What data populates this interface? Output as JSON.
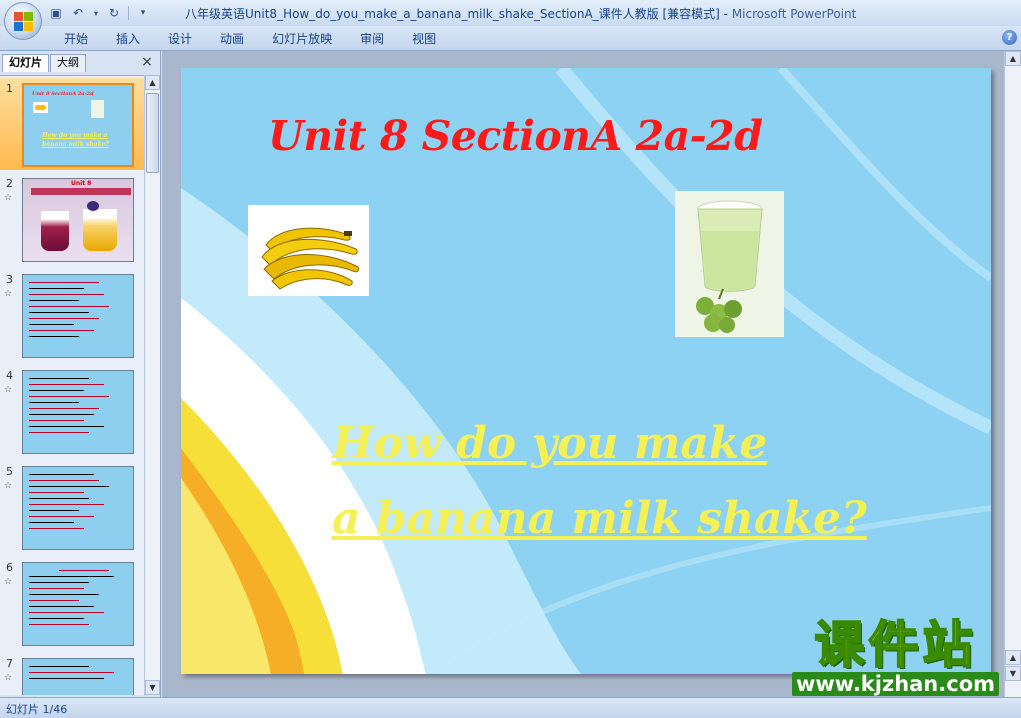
{
  "window": {
    "title": "八年级英语Unit8_How_do_you_make_a_banana_milk_shake_SectionA_课件人教版 [兼容模式]",
    "app_name": "Microsoft PowerPoint"
  },
  "ribbon": {
    "tabs": [
      "开始",
      "插入",
      "设计",
      "动画",
      "幻灯片放映",
      "审阅",
      "视图"
    ],
    "help_label": "?"
  },
  "left_panel": {
    "tabs": [
      "幻灯片",
      "大纲"
    ],
    "close_label": "×",
    "thumbnails": [
      {
        "number": "1",
        "title": "Unit 8 SectionA 2a-2d",
        "subtitle": "How do you make a banana milk shake?"
      },
      {
        "number": "2",
        "title": "Unit 8"
      },
      {
        "number": "3"
      },
      {
        "number": "4"
      },
      {
        "number": "5"
      },
      {
        "number": "6"
      },
      {
        "number": "7"
      }
    ]
  },
  "slide": {
    "title": "Unit 8 SectionA 2a-2d",
    "subtitle_line1": "How do you make",
    "subtitle_line2": "a banana milk shake?"
  },
  "watermark": {
    "chinese": "课件站",
    "url": "www.kjzhan.com"
  },
  "status_bar": {
    "slide_info": "幻灯片 1/46"
  },
  "colors": {
    "slide_bg": "#8dd2f3",
    "title_red": "#ff1a1a",
    "subtitle_yellow": "#f5f056",
    "selected_thumb": "#ffb94f"
  }
}
